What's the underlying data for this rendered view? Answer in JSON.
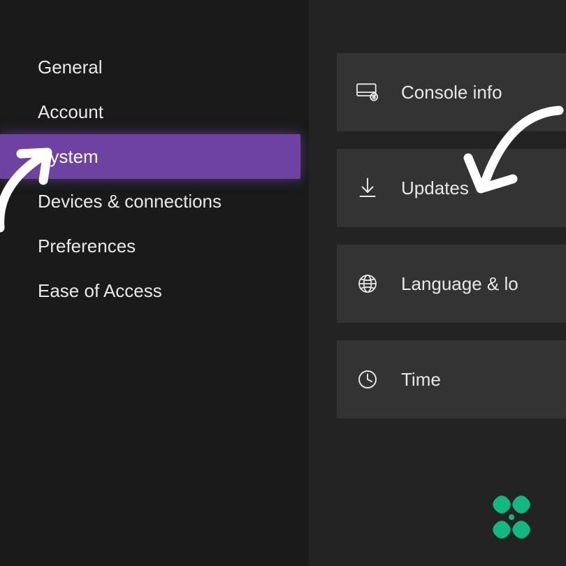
{
  "colors": {
    "accent": "#6e42a3",
    "tile_bg": "#333333",
    "sidebar_bg": "#1a1a1a",
    "main_bg": "#232323",
    "logo_green": "#10b981",
    "arrow_white": "#ffffff"
  },
  "sidebar": {
    "items": [
      {
        "label": "General"
      },
      {
        "label": "Account"
      },
      {
        "label": "System",
        "selected": true
      },
      {
        "label": "Devices & connections"
      },
      {
        "label": "Preferences"
      },
      {
        "label": "Ease of Access"
      }
    ]
  },
  "tiles": [
    {
      "icon": "console-info-icon",
      "label": "Console info"
    },
    {
      "icon": "download-icon",
      "label": "Updates"
    },
    {
      "icon": "globe-icon",
      "label": "Language & lo"
    },
    {
      "icon": "clock-icon",
      "label": "Time"
    }
  ]
}
